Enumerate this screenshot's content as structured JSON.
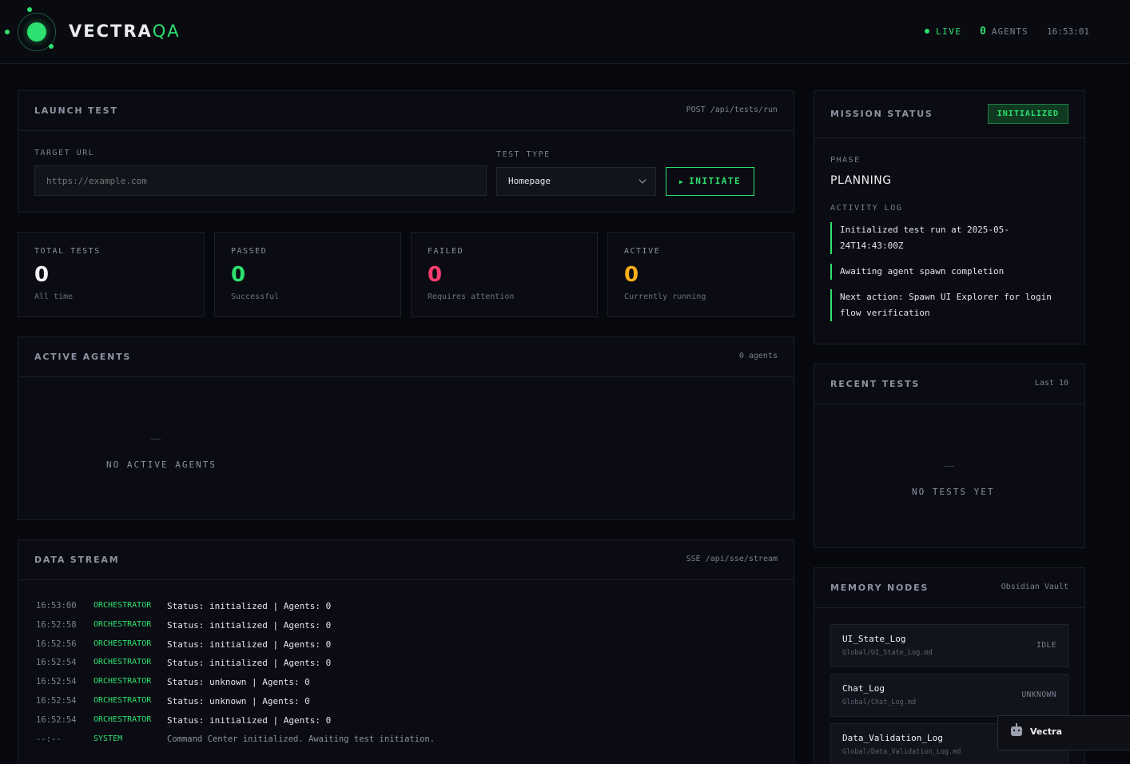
{
  "header": {
    "brand_main": "VECTRA",
    "brand_accent": "QA",
    "live_label": "LIVE",
    "agents_num": "0",
    "agents_label": "AGENTS",
    "clock": "16:53:01"
  },
  "launch": {
    "title": "LAUNCH TEST",
    "endpoint": "POST /api/tests/run",
    "url_label": "TARGET URL",
    "url_placeholder": "https://example.com",
    "type_label": "TEST TYPE",
    "type_value": "Homepage",
    "initiate_label": "INITIATE"
  },
  "stats": [
    {
      "label": "TOTAL TESTS",
      "value": "0",
      "sub": "All time",
      "color": "#f2f3f6"
    },
    {
      "label": "PASSED",
      "value": "0",
      "sub": "Successful",
      "color": "#2ee06f"
    },
    {
      "label": "FAILED",
      "value": "0",
      "sub": "Requires attention",
      "color": "#ff3d71"
    },
    {
      "label": "ACTIVE",
      "value": "0",
      "sub": "Currently running",
      "color": "#ffae1a"
    }
  ],
  "agents_panel": {
    "title": "ACTIVE AGENTS",
    "meta": "0 agents",
    "empty": "NO ACTIVE AGENTS"
  },
  "stream": {
    "title": "DATA STREAM",
    "meta": "SSE /api/sse/stream",
    "rows": [
      {
        "time": "16:53:00",
        "source": "ORCHESTRATOR",
        "msg": "Status: initialized | Agents: 0"
      },
      {
        "time": "16:52:58",
        "source": "ORCHESTRATOR",
        "msg": "Status: initialized | Agents: 0"
      },
      {
        "time": "16:52:56",
        "source": "ORCHESTRATOR",
        "msg": "Status: initialized | Agents: 0"
      },
      {
        "time": "16:52:54",
        "source": "ORCHESTRATOR",
        "msg": "Status: initialized | Agents: 0"
      },
      {
        "time": "16:52:54",
        "source": "ORCHESTRATOR",
        "msg": "Status: unknown | Agents: 0"
      },
      {
        "time": "16:52:54",
        "source": "ORCHESTRATOR",
        "msg": "Status: unknown | Agents: 0"
      },
      {
        "time": "16:52:54",
        "source": "ORCHESTRATOR",
        "msg": "Status: initialized | Agents: 0"
      },
      {
        "time": "--:--",
        "source": "SYSTEM",
        "msg": "Command Center initialized. Awaiting test initiation."
      }
    ]
  },
  "mission": {
    "title": "MISSION STATUS",
    "badge": "INITIALIZED",
    "phase_label": "PHASE",
    "phase_value": "PLANNING",
    "log_label": "ACTIVITY LOG",
    "activity": [
      "Initialized test run at 2025-05-24T14:43:00Z",
      "Awaiting agent spawn completion",
      "Next action: Spawn UI Explorer for login flow verification"
    ]
  },
  "recent": {
    "title": "RECENT TESTS",
    "meta": "Last 10",
    "empty": "NO TESTS YET"
  },
  "memory": {
    "title": "MEMORY NODES",
    "meta": "Obsidian Vault",
    "nodes": [
      {
        "name": "UI_State_Log",
        "path": "Global/UI_State_Log.md",
        "status": "IDLE"
      },
      {
        "name": "Chat_Log",
        "path": "Global/Chat_Log.md",
        "status": "UNKNOWN"
      },
      {
        "name": "Data_Validation_Log",
        "path": "Global/Data_Validation_Log.md",
        "status": ""
      }
    ]
  },
  "assistant": {
    "label": "Vectra",
    "icon": "robot-icon"
  }
}
